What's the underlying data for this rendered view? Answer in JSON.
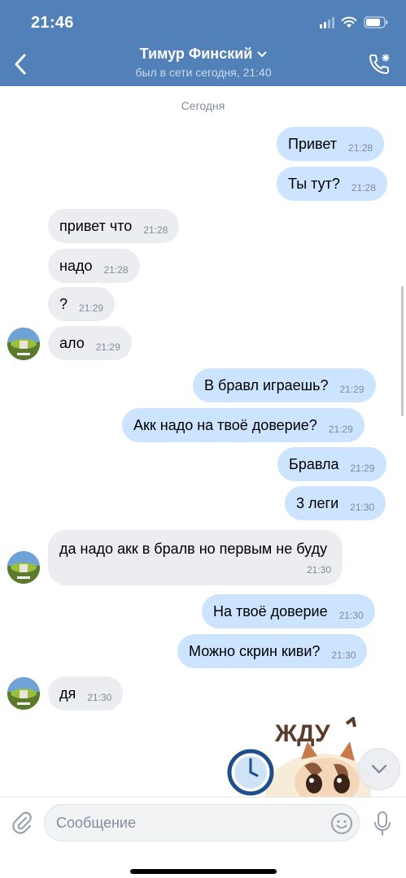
{
  "status_bar": {
    "time": "21:46"
  },
  "header": {
    "title": "Тимур Финский",
    "subtitle": "был в сети сегодня, 21:40"
  },
  "chat": {
    "date_separator": "Сегодня",
    "messages": [
      {
        "dir": "out",
        "text": "Привет",
        "time": "21:28"
      },
      {
        "dir": "out",
        "text": "Ты тут?",
        "time": "21:28"
      },
      {
        "dir": "in",
        "text": "привет что",
        "time": "21:28"
      },
      {
        "dir": "in",
        "text": "надо",
        "time": "21:28"
      },
      {
        "dir": "in",
        "text": "?",
        "time": "21:29"
      },
      {
        "dir": "in",
        "text": "ало",
        "time": "21:29"
      },
      {
        "dir": "out",
        "text": "В бравл играешь?",
        "time": "21:29"
      },
      {
        "dir": "out",
        "text": "Акк надо на твоё доверие?",
        "time": "21:29"
      },
      {
        "dir": "out",
        "text": "Бравла",
        "time": "21:29"
      },
      {
        "dir": "out",
        "text": "3 леги",
        "time": "21:30"
      },
      {
        "dir": "in",
        "text": "да надо акк в бралв но первым не буду",
        "time": "21:30"
      },
      {
        "dir": "out",
        "text": "На твоё доверие",
        "time": "21:30"
      },
      {
        "dir": "out",
        "text": "Можно скрин киви?",
        "time": "21:30"
      },
      {
        "dir": "in",
        "text": "дя",
        "time": "21:30"
      }
    ],
    "sticker_text": "ЖДУ"
  },
  "composer": {
    "placeholder": "Сообщение"
  },
  "icons": {
    "back": "chevron-left-icon",
    "title_dropdown": "chevron-down-icon",
    "call": "phone-call-icon",
    "attach": "paperclip-icon",
    "emoji": "smile-icon",
    "mic": "microphone-icon",
    "scroll": "chevron-down-icon"
  },
  "colors": {
    "header_bg": "#5181b8",
    "outgoing_bubble": "#cce4ff",
    "incoming_bubble": "#ebedf0",
    "timestamp": "#818c99"
  }
}
